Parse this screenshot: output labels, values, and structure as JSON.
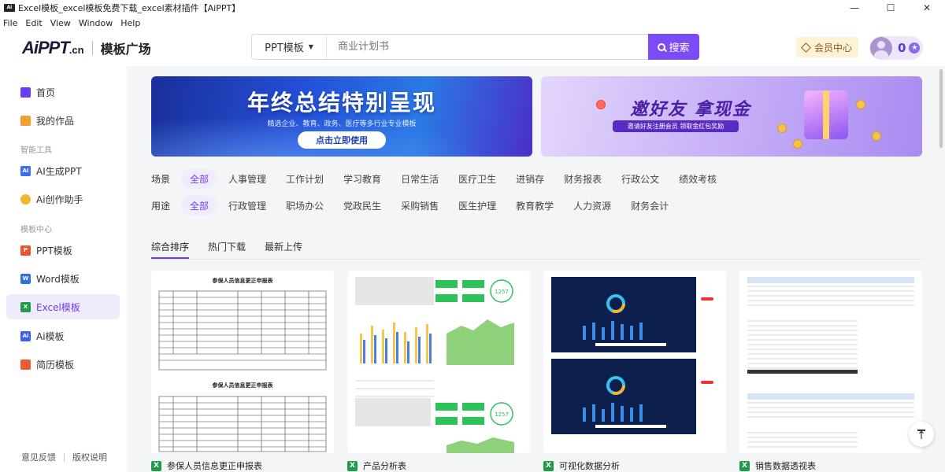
{
  "window": {
    "title": "Excel模板_excel模板免费下载_excel素材插件【AiPPT】",
    "controls": [
      "—",
      "☐",
      "✕"
    ]
  },
  "menu": [
    "File",
    "Edit",
    "View",
    "Window",
    "Help"
  ],
  "header": {
    "brand": "AiPPT",
    "brand_suffix": ".cn",
    "section": "模板广场",
    "search_type": "PPT模板",
    "search_placeholder": "商业计划书",
    "search_button": "搜索",
    "vip_label": "会员中心",
    "points": "0"
  },
  "sidebar": {
    "items": [
      {
        "label": "首页",
        "icon": "home-icon"
      },
      {
        "label": "我的作品",
        "icon": "folder-icon"
      },
      {
        "label": "AI生成PPT",
        "icon": "ai-icon"
      },
      {
        "label": "Ai创作助手",
        "icon": "chat-icon"
      },
      {
        "label": "PPT模板",
        "icon": "ppt-icon"
      },
      {
        "label": "Word模板",
        "icon": "word-icon"
      },
      {
        "label": "Excel模板",
        "icon": "excel-icon"
      },
      {
        "label": "Ai模板",
        "icon": "ai-template-icon"
      },
      {
        "label": "简历模板",
        "icon": "resume-icon"
      }
    ],
    "group_tools": "智能工具",
    "group_templates": "模板中心",
    "feedback": "意见反馈",
    "copyright": "版权说明"
  },
  "banners": {
    "left_title": "年终总结特别呈现",
    "left_subtitle": "精选企业、教育、政务、医疗等多行业专业模板",
    "left_button": "点击立即使用",
    "right_title": "邀好友 拿现金",
    "right_subtitle": "邀请好友注册会员 领取金红包奖励"
  },
  "filters": {
    "scene_label": "场景",
    "scene": [
      "全部",
      "人事管理",
      "工作计划",
      "学习教育",
      "日常生活",
      "医疗卫生",
      "进销存",
      "财务报表",
      "行政公文",
      "绩效考核"
    ],
    "usage_label": "用途",
    "usage": [
      "全部",
      "行政管理",
      "职场办公",
      "党政民生",
      "采购销售",
      "医生护理",
      "教育教学",
      "人力资源",
      "财务会计"
    ]
  },
  "sort_tabs": [
    "综合排序",
    "热门下载",
    "最新上传"
  ],
  "cards": [
    {
      "title": "参保人员信息更正申报表",
      "sheet_title": "参保人员信息更正申报表"
    },
    {
      "title": "产品分析表",
      "badge": "1257"
    },
    {
      "title": "可视化数据分析"
    },
    {
      "title": "销售数据透视表"
    }
  ],
  "colors": {
    "accent": "#7b4cf5",
    "excel_green": "#1f9b4a"
  }
}
